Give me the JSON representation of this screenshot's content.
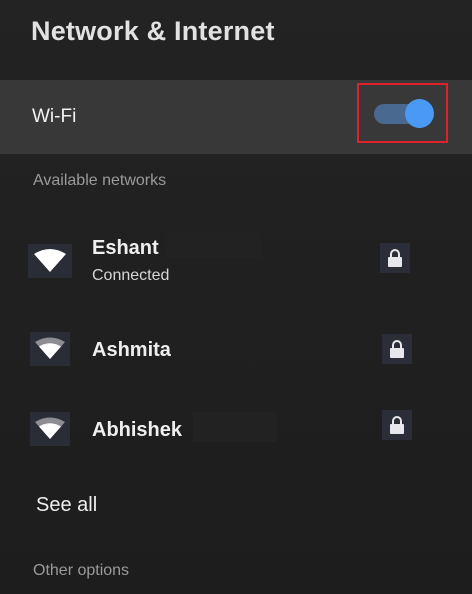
{
  "header": {
    "title": "Network & Internet"
  },
  "wifi": {
    "label": "Wi-Fi",
    "enabled": true
  },
  "available": {
    "label": "Available networks",
    "networks": [
      {
        "name": "Eshant",
        "status": "Connected",
        "icon": "wifi-signal-full-icon",
        "secured": true
      },
      {
        "name": "Ashmita",
        "status": "",
        "icon": "wifi-signal-strong-icon",
        "secured": true
      },
      {
        "name": "Abhishek",
        "status": "",
        "icon": "wifi-signal-strong-icon",
        "secured": true
      }
    ]
  },
  "see_all": {
    "label": "See all"
  },
  "other": {
    "label": "Other options"
  },
  "colors": {
    "accent": "#4a9af5",
    "highlight": "#e0202a",
    "background": "#1f1f1f",
    "selected_row": "#383838"
  }
}
